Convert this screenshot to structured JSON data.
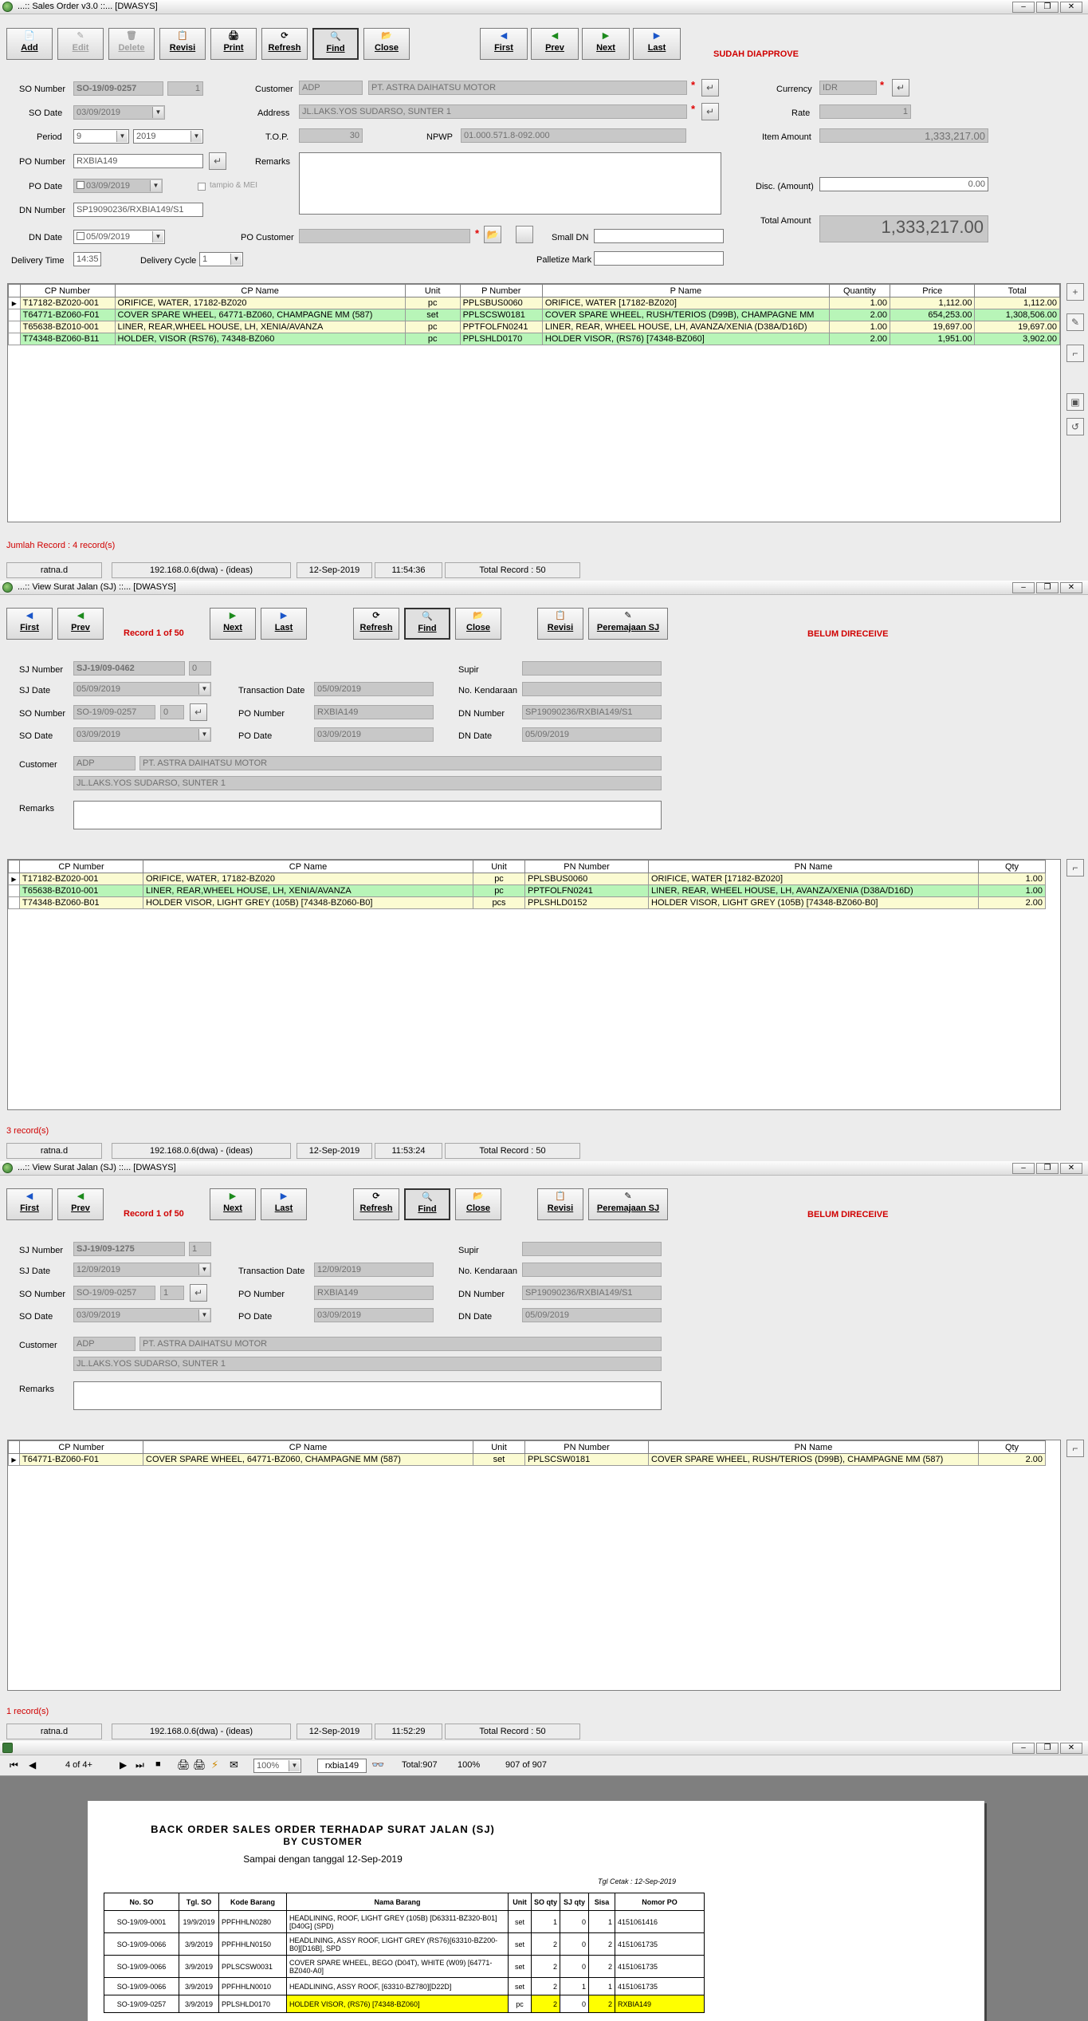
{
  "so_window": {
    "title": "...:: Sales Order v3.0 ::...  [DWASYS]",
    "toolbar": [
      "Add",
      "Edit",
      "Delete",
      "Revisi",
      "Print",
      "Refresh",
      "Find",
      "Close"
    ],
    "nav": [
      "First",
      "Prev",
      "Next",
      "Last"
    ],
    "status_text": "SUDAH DIAPPROVE",
    "labels": {
      "so_number": "SO Number",
      "so_date": "SO Date",
      "period": "Period",
      "po_number": "PO Number",
      "po_date": "PO Date",
      "dn_number": "DN Number",
      "dn_date": "DN Date",
      "delivery_time": "Delivery Time",
      "delivery_cycle": "Delivery Cycle",
      "customer": "Customer",
      "address": "Address",
      "top": "T.O.P.",
      "npwp": "NPWP",
      "remarks": "Remarks",
      "po_customer": "PO Customer",
      "small_dn": "Small DN",
      "palletize_mark": "Palletize Mark",
      "currency": "Currency",
      "rate": "Rate",
      "item_amount": "Item Amount",
      "disc_amount": "Disc. (Amount)",
      "total_amount": "Total Amount",
      "tampio": "tampio & MEI"
    },
    "values": {
      "so_number": "SO-19/09-0257",
      "so_rev": "1",
      "so_date": "03/09/2019",
      "period_month": "9",
      "period_year": "2019",
      "po_number": "RXBIA149",
      "po_date": "03/09/2019",
      "dn_number": "SP19090236/RXBIA149/S1",
      "dn_date": "05/09/2019",
      "delivery_time": "14:35",
      "delivery_cycle": "1",
      "customer_code": "ADP",
      "customer_name": "PT. ASTRA DAIHATSU MOTOR",
      "address": "JL.LAKS.YOS SUDARSO, SUNTER 1",
      "top": "30",
      "npwp": "01.000.571.8-092.000",
      "currency": "IDR",
      "rate": "1",
      "item_amount": "1,333,217.00",
      "disc_amount": "0.00",
      "total_amount": "1,333,217.00"
    },
    "columns": [
      "CP Number",
      "CP Name",
      "Unit",
      "P Number",
      "P Name",
      "Quantity",
      "Price",
      "Total"
    ],
    "rows": [
      [
        "T17182-BZ020-001",
        "ORIFICE, WATER, 17182-BZ020",
        "pc",
        "PPLSBUS0060",
        "ORIFICE, WATER [17182-BZ020]",
        "1.00",
        "1,112.00",
        "1,112.00"
      ],
      [
        "T64771-BZ060-F01",
        "COVER SPARE WHEEL, 64771-BZ060, CHAMPAGNE MM (587)",
        "set",
        "PPLSCSW0181",
        "COVER SPARE WHEEL, RUSH/TERIOS (D99B), CHAMPAGNE MM",
        "2.00",
        "654,253.00",
        "1,308,506.00"
      ],
      [
        "T65638-BZ010-001",
        "LINER, REAR,WHEEL HOUSE, LH, XENIA/AVANZA",
        "pc",
        "PPTFOLFN0241",
        "LINER, REAR, WHEEL HOUSE, LH, AVANZA/XENIA (D38A/D16D)",
        "1.00",
        "19,697.00",
        "19,697.00"
      ],
      [
        "T74348-BZ060-B11",
        "HOLDER, VISOR (RS76), 74348-BZ060",
        "pc",
        "PPLSHLD0170",
        "HOLDER VISOR, (RS76) [74348-BZ060]",
        "2.00",
        "1,951.00",
        "3,902.00"
      ]
    ],
    "jumlah_record": "Jumlah Record  :  4 record(s)",
    "statusbar": [
      "ratna.d",
      "192.168.0.6(dwa) - (ideas)",
      "12-Sep-2019",
      "11:54:36",
      "Total Record  :  50"
    ]
  },
  "sj1": {
    "title": "...:: View Surat Jalan (SJ) ::...  [DWASYS]",
    "toolbar": [
      "First",
      "Prev",
      "Next",
      "Last",
      "Refresh",
      "Find",
      "Close",
      "Revisi",
      "Peremajaan SJ"
    ],
    "record_text": "Record 1 of 50",
    "status_text": "BELUM DIRECEIVE",
    "labels": {
      "sj_number": "SJ Number",
      "sj_date": "SJ Date",
      "so_number": "SO Number",
      "so_date": "SO Date",
      "customer": "Customer",
      "remarks": "Remarks",
      "transaction_date": "Transaction Date",
      "po_number": "PO Number",
      "po_date": "PO Date",
      "supir": "Supir",
      "no_kendaraan": "No. Kendaraan",
      "dn_number": "DN Number",
      "dn_date": "DN Date"
    },
    "values": {
      "sj_number": "SJ-19/09-0462",
      "sj_rev": "0",
      "sj_date": "05/09/2019",
      "so_number": "SO-19/09-0257",
      "so_rev": "0",
      "so_date": "03/09/2019",
      "transaction_date": "05/09/2019",
      "po_number": "RXBIA149",
      "po_date": "03/09/2019",
      "dn_number": "SP19090236/RXBIA149/S1",
      "dn_date": "05/09/2019",
      "customer_code": "ADP",
      "customer_name": "PT. ASTRA DAIHATSU MOTOR",
      "address": "JL.LAKS.YOS SUDARSO, SUNTER 1"
    },
    "columns": [
      "CP Number",
      "CP Name",
      "Unit",
      "PN Number",
      "PN Name",
      "Qty"
    ],
    "rows": [
      [
        "T17182-BZ020-001",
        "ORIFICE, WATER, 17182-BZ020",
        "pc",
        "PPLSBUS0060",
        "ORIFICE, WATER [17182-BZ020]",
        "1.00"
      ],
      [
        "T65638-BZ010-001",
        "LINER, REAR,WHEEL HOUSE, LH, XENIA/AVANZA",
        "pc",
        "PPTFOLFN0241",
        "LINER, REAR, WHEEL HOUSE, LH, AVANZA/XENIA (D38A/D16D)",
        "1.00"
      ],
      [
        "T74348-BZ060-B01",
        "HOLDER VISOR, LIGHT GREY (105B) [74348-BZ060-B0]",
        "pcs",
        "PPLSHLD0152",
        "HOLDER VISOR, LIGHT GREY (105B) [74348-BZ060-B0]",
        "2.00"
      ]
    ],
    "record_count": "3 record(s)",
    "statusbar": [
      "ratna.d",
      "192.168.0.6(dwa) - (ideas)",
      "12-Sep-2019",
      "11:53:24",
      "Total Record  :  50"
    ]
  },
  "sj2": {
    "title": "...:: View Surat Jalan (SJ) ::...  [DWASYS]",
    "record_text": "Record 1 of 50",
    "status_text": "BELUM DIRECEIVE",
    "values": {
      "sj_number": "SJ-19/09-1275",
      "sj_rev": "1",
      "sj_date": "12/09/2019",
      "so_number": "SO-19/09-0257",
      "so_rev": "1",
      "so_date": "03/09/2019",
      "transaction_date": "12/09/2019",
      "po_number": "RXBIA149",
      "po_date": "03/09/2019",
      "dn_number": "SP19090236/RXBIA149/S1",
      "dn_date": "05/09/2019",
      "customer_code": "ADP",
      "customer_name": "PT. ASTRA DAIHATSU MOTOR",
      "address": "JL.LAKS.YOS SUDARSO, SUNTER 1"
    },
    "rows": [
      [
        "T64771-BZ060-F01",
        "COVER SPARE WHEEL, 64771-BZ060, CHAMPAGNE MM (587)",
        "set",
        "PPLSCSW0181",
        "COVER SPARE WHEEL, RUSH/TERIOS (D99B), CHAMPAGNE MM (587)",
        "2.00"
      ]
    ],
    "record_count": "1 record(s)",
    "statusbar": [
      "ratna.d",
      "192.168.0.6(dwa) - (ideas)",
      "12-Sep-2019",
      "11:52:29",
      "Total Record  :  50"
    ]
  },
  "report": {
    "page_info": "4 of 4+",
    "zoom": "100%",
    "search_value": "rxbia149",
    "total": "Total:907",
    "percent": "100%",
    "count": "907 of 907",
    "title1": "BACK ORDER SALES ORDER TERHADAP SURAT JALAN (SJ)",
    "title2": "BY CUSTOMER",
    "subtitle": "Sampai dengan tanggal 12-Sep-2019",
    "tgl_cetak": "Tgl Cetak :  12-Sep-2019",
    "columns": [
      "No. SO",
      "Tgl. SO",
      "Kode Barang",
      "Nama Barang",
      "Unit",
      "SO qty",
      "SJ qty",
      "Sisa",
      "Nomor PO"
    ],
    "rows": [
      [
        "SO-19/09-0001",
        "19/9/2019",
        "PPFHHLN0280",
        "HEADLINING, ROOF, LIGHT GREY (105B) [D63311-BZ320-B01] [D40G] (SPD)",
        "set",
        "1",
        "0",
        "1",
        "4151061416"
      ],
      [
        "SO-19/09-0066",
        "3/9/2019",
        "PPFHHLN0150",
        "HEADLINING, ASSY ROOF, LIGHT GREY (RS76)[63310-BZ200-B0][D16B], SPD",
        "set",
        "2",
        "0",
        "2",
        "4151061735"
      ],
      [
        "SO-19/09-0066",
        "3/9/2019",
        "PPLSCSW0031",
        "COVER SPARE WHEEL, BEGO (D04T), WHITE (W09) [64771-BZ040-A0]",
        "set",
        "2",
        "0",
        "2",
        "4151061735"
      ],
      [
        "SO-19/09-0066",
        "3/9/2019",
        "PPFHHLN0010",
        "HEADLINING, ASSY ROOF, [63310-BZ780][D22D]",
        "set",
        "2",
        "1",
        "1",
        "4151061735"
      ],
      [
        "SO-19/09-0257",
        "3/9/2019",
        "PPLSHLD0170",
        "HOLDER VISOR, (RS76) [74348-BZ060]",
        "pc",
        "2",
        "0",
        "2",
        "RXBIA149"
      ]
    ]
  }
}
